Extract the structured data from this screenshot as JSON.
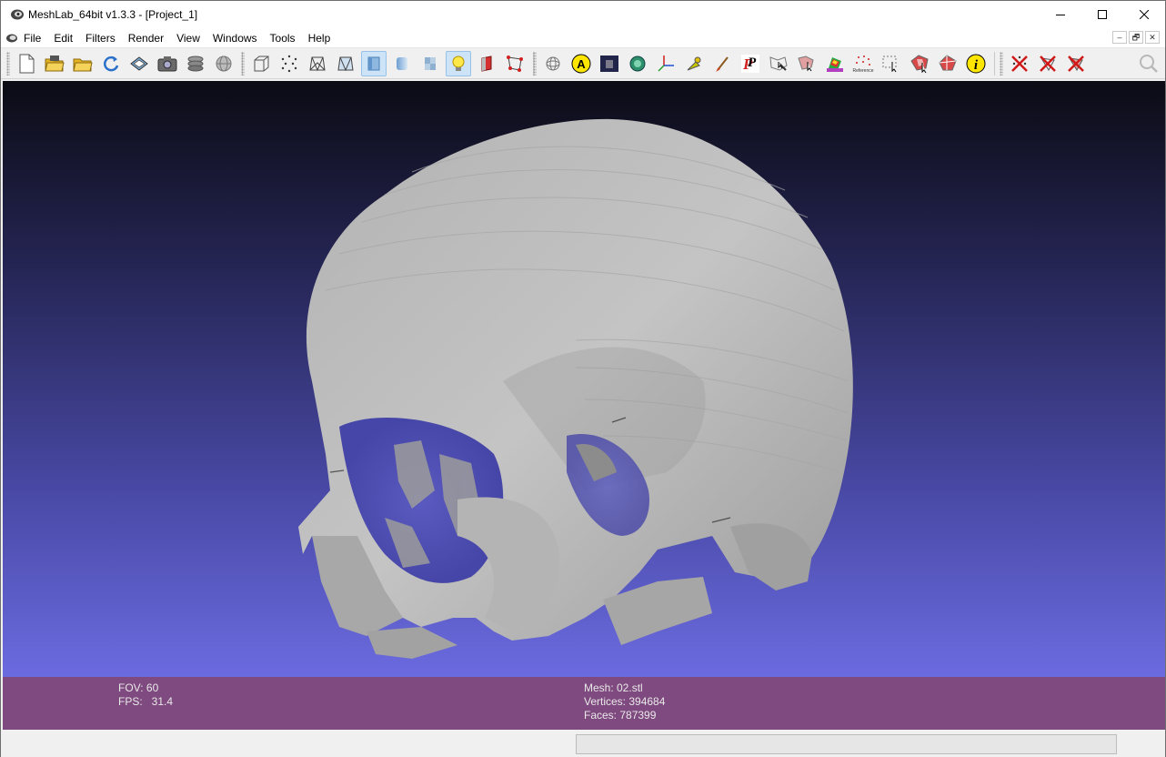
{
  "window": {
    "title": "MeshLab_64bit v1.3.3 - [Project_1]",
    "controls": [
      "minimize",
      "maximize",
      "close"
    ]
  },
  "menu": {
    "items": [
      {
        "label": "File"
      },
      {
        "label": "Edit"
      },
      {
        "label": "Filters"
      },
      {
        "label": "Render"
      },
      {
        "label": "View"
      },
      {
        "label": "Windows"
      },
      {
        "label": "Tools"
      },
      {
        "label": "Help"
      }
    ],
    "mdi_controls": [
      "–",
      "🗗",
      "✕"
    ]
  },
  "toolbar": {
    "file_group": [
      "new-project-icon",
      "open-project-icon",
      "open-mesh-icon",
      "reload-icon",
      "save-snapshot-icon",
      "camera-icon",
      "layers-icon",
      "mesh-layer-icon"
    ],
    "render_group": [
      "bounding-box-icon",
      "points-icon",
      "wireframe-icon",
      "hidden-lines-icon",
      "flat-shading-icon",
      "smooth-shading-icon",
      "texture-icon",
      "lighting-icon",
      "backface-icon",
      "select-faces-icon"
    ],
    "render_active": [
      "flat-shading-icon",
      "lighting-icon"
    ],
    "edit_group": [
      "trackball-icon",
      "annotation-icon",
      "painter-icon",
      "quality-icon",
      "axis-icon",
      "measure-icon",
      "brush-icon",
      "pickpoints-icon",
      "select-vertices-icon",
      "select-connected-icon",
      "color-paint-icon",
      "reference-icon",
      "align-icon",
      "manipulator-icon",
      "segment-icon",
      "info-icon"
    ],
    "delete_group": [
      "delete-vertices-icon",
      "delete-faces-icon",
      "delete-faces-vertices-icon"
    ],
    "search_icon": "search-icon",
    "reference_label": "Reference"
  },
  "viewport": {
    "background_top": "#0b0b14",
    "background_bottom": "#6b6be0",
    "model": "skull-mesh"
  },
  "info": {
    "fov_label": "FOV: 60",
    "fps_label": "FPS:   31.4",
    "mesh_label": "Mesh: 02.stl",
    "vertices_label": "Vertices: 394684",
    "faces_label": "Faces: 787399",
    "background": "#7f4a7f"
  },
  "status": {
    "progress": 0
  }
}
